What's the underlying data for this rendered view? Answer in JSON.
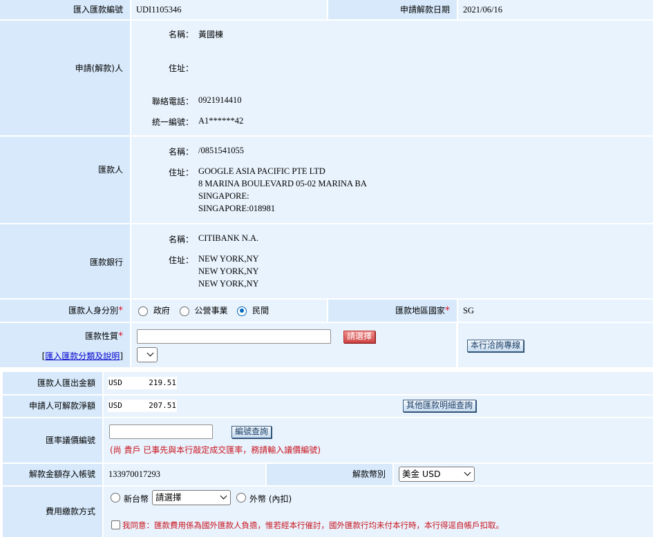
{
  "remittance_no": {
    "label": "匯入匯款編號",
    "value": "UDI1105346"
  },
  "apply_date": {
    "label": "申請解款日期",
    "value": "2021/06/16"
  },
  "applicant": {
    "label": "申請(解款)人",
    "name_label": "名稱：",
    "name": "黃國棟",
    "address_label": "住址：",
    "address": "",
    "phone_label": "聯絡電話：",
    "phone": "0921914410",
    "id_label": "統一編號：",
    "id": "A1******42"
  },
  "remitter": {
    "label": "匯款人",
    "name_label": "名稱：",
    "name": "/0851541055",
    "address_label": "住址：",
    "address_lines": [
      "GOOGLE ASIA PACIFIC PTE LTD",
      "8 MARINA BOULEVARD 05-02 MARINA BA",
      "SINGAPORE:",
      "SINGAPORE:018981"
    ]
  },
  "remit_bank": {
    "label": "匯款銀行",
    "name_label": "名稱：",
    "name": "CITIBANK N.A.",
    "address_label": "住址：",
    "address_lines": [
      "NEW YORK,NY",
      "NEW YORK,NY",
      "NEW YORK,NY"
    ]
  },
  "remitter_identity": {
    "label": "匯款人身分別",
    "options": [
      "政府",
      "公營事業",
      "民間"
    ],
    "selected": "民間"
  },
  "remit_country": {
    "label": "匯款地區國家",
    "value": "SG"
  },
  "remit_nature": {
    "label": "匯款性質",
    "link": "匯入匯款分類及說明",
    "value": "",
    "choose_button": "請選擇",
    "contact_button": "本行洽詢專線"
  },
  "outgoing_amount": {
    "label": "匯款人匯出金額",
    "currency": "USD",
    "amount": "219.51"
  },
  "net_amount": {
    "label": "申請人可解款淨額",
    "currency": "USD",
    "amount": "207.51",
    "button": "其他匯款明細查詢"
  },
  "rate_ref": {
    "label": "匯率議價編號",
    "value": "",
    "button": "編號查詢",
    "note": "(尚 貴戶 已事先與本行敲定成交匯率，務請輸入議價編號)"
  },
  "deposit_account": {
    "label": "解款金額存入帳號",
    "value": "133970017293"
  },
  "currency_select": {
    "label": "解款幣別",
    "selected": "美金 USD"
  },
  "fee_method": {
    "label": "費用繳款方式",
    "option_twd": "新台幣",
    "twd_select": "請選擇",
    "option_foreign": "外幣 (內扣)",
    "agree_label": "我同意：匯款費用係為國外匯款人負擔，惟若經本行催討，國外匯款行均未付本行時，本行得逕自帳戶扣取。"
  },
  "colors": {
    "label_bg": "#d7e9fb",
    "value_bg": "#e9f3fd",
    "required": "#e0142a",
    "note": "#c8141e"
  }
}
